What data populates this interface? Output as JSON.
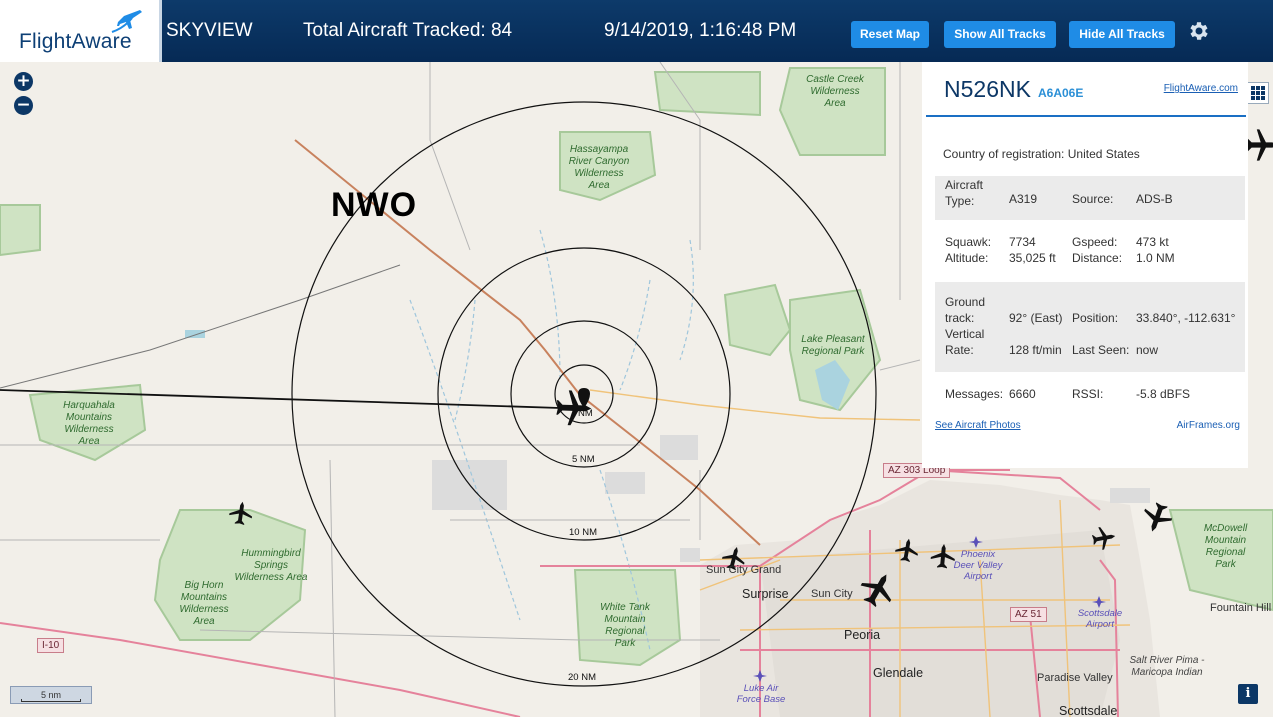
{
  "header": {
    "logo_text": "FlightAware",
    "app_name": "SKYVIEW",
    "total_tracked": "Total Aircraft Tracked: 84",
    "datetime": "9/14/2019, 1:16:48 PM",
    "buttons": {
      "reset": "Reset Map",
      "show_all": "Show All Tracks",
      "hide_all": "Hide All Tracks"
    },
    "settings_icon": "gear-icon"
  },
  "map": {
    "zoom_in": "+",
    "zoom_out": "−",
    "site_label": "NWO",
    "range_rings": [
      "5 NM",
      "10 NM",
      "20 NM"
    ],
    "range_ring_small": "NM",
    "scale_label": "5 nm",
    "info_button": "i",
    "places": {
      "castle_creek": "Castle Creek Wilderness Area",
      "hassayampa": "Hassayampa River Canyon Wilderness Area",
      "harquahala": "Harquahala Mountains Wilderness Area",
      "hummingbird": "Hummingbird Springs Wilderness Area",
      "big_horn": "Big Horn Mountains Wilderness Area",
      "lake_pleasant": "Lake Pleasant Regional Park",
      "white_tank": "White Tank Mountain Regional Park",
      "mcdowell": "McDowell Mountain Regional Park",
      "salt_river": "Salt River Pima - Maricopa Indian",
      "sun_city_grand": "Sun City Grand",
      "surprise": "Surprise",
      "sun_city": "Sun City",
      "peoria": "Peoria",
      "glendale": "Glendale",
      "paradise_valley": "Paradise Valley",
      "scottsdale": "Scottsdale",
      "fountain_hills": "Fountain Hill",
      "phoenix_dv_airport": "Phoenix Deer Valley Airport",
      "scottsdale_airport": "Scottsdale Airport",
      "luke_afb": "Luke Air Force Base"
    },
    "roads": {
      "az303": "AZ 303 Loop",
      "az51": "AZ 51",
      "i10": "I-10"
    }
  },
  "panel": {
    "callsign": "N526NK",
    "hex": "A6A06E",
    "fa_link": "FlightAware.com",
    "country_label": "Country of registration:",
    "country_value": "United States",
    "aircraft_type_label": "Aircraft Type:",
    "aircraft_type_value": "A319",
    "source_label": "Source:",
    "source_value": "ADS-B",
    "squawk_label": "Squawk:",
    "squawk_value": "7734",
    "altitude_label": "Altitude:",
    "altitude_value": "35,025 ft",
    "gspeed_label": "Gspeed:",
    "gspeed_value": "473 kt",
    "distance_label": "Distance:",
    "distance_value": "1.0 NM",
    "ground_track_label": "Ground track:",
    "ground_track_value": "92° (East)",
    "position_label": "Position:",
    "position_value": "33.840°, -112.631°",
    "vrate_label": "Vertical Rate:",
    "vrate_value": "128 ft/min",
    "last_seen_label": "Last Seen:",
    "last_seen_value": "now",
    "messages_label": "Messages:",
    "messages_value": "6660",
    "rssi_label": "RSSI:",
    "rssi_value": "-5.8 dBFS",
    "photos_link": "See Aircraft Photos",
    "airframes_link": "AirFrames.org"
  }
}
